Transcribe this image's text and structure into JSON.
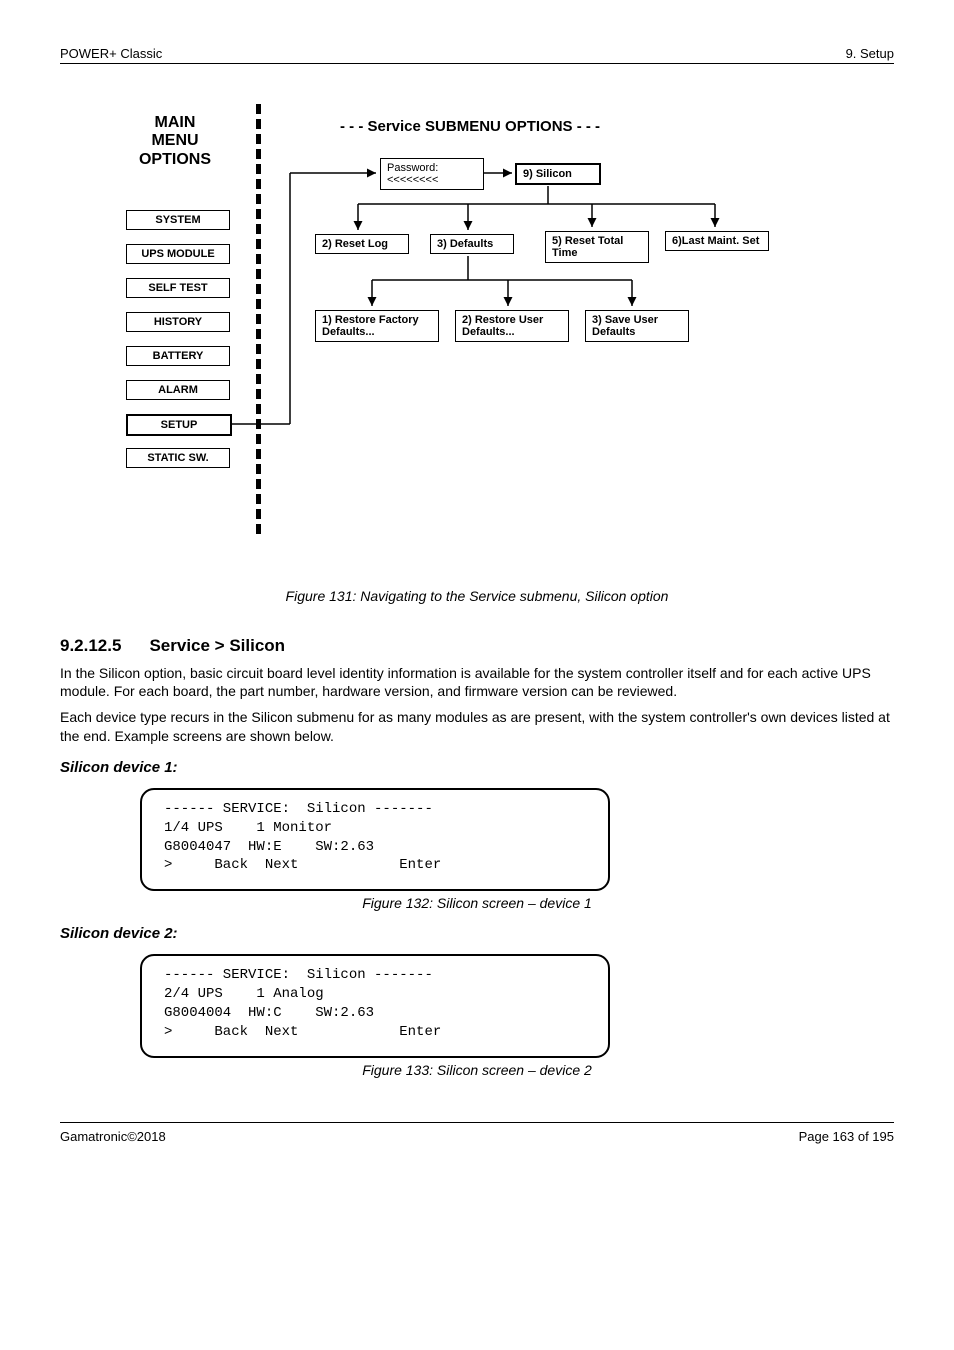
{
  "header": {
    "left": "POWER+ Classic",
    "right": "9. Setup"
  },
  "diagram": {
    "main_menu_title": "MAIN\nMENU\nOPTIONS",
    "main_items": [
      "SYSTEM",
      "UPS MODULE",
      "SELF TEST",
      "HISTORY",
      "BATTERY",
      "ALARM",
      "SETUP",
      "STATIC SW."
    ],
    "submenu_title": "- - -     Service SUBMENU OPTIONS     - - -",
    "password_box": "Password:\n<<<<<<<<",
    "silicon": "9) Silicon",
    "row2": [
      "2) Reset Log",
      "3) Defaults",
      "5) Reset Total Time",
      "6)Last Maint. Set"
    ],
    "row3": [
      "1) Restore Factory Defaults...",
      "2) Restore User Defaults...",
      "3) Save User Defaults"
    ]
  },
  "figure_caption": "Figure 131: Navigating to the Service submenu, Silicon option",
  "section": {
    "num": "9.2.12.5",
    "title": "Service > Silicon"
  },
  "body": {
    "p1": "In the Silicon option, basic circuit board level identity information is available for the system controller itself and for each active UPS module. For each board, the part number, hardware version, and firmware version can be reviewed.",
    "p2": "Each device type recurs in the Silicon submenu for as many modules as are present, with the system controller's own devices listed at the end. Example screens are shown below."
  },
  "device1": {
    "label": "Silicon device 1:",
    "lcd": {
      "l1": "------ SERVICE:  Silicon -------",
      "l2": "1/4 UPS    1 Monitor",
      "l3": "G8004047  HW:E    SW:2.63",
      "l4": ">     Back  Next            Enter"
    },
    "caption": "Figure 132: Silicon screen – device 1"
  },
  "device2": {
    "label": "Silicon device 2:",
    "lcd": {
      "l1": "------ SERVICE:  Silicon -------",
      "l2": "2/4 UPS    1 Analog",
      "l3": "G8004004  HW:C    SW:2.63",
      "l4": ">     Back  Next            Enter"
    },
    "caption": "Figure 133: Silicon screen – device 2"
  },
  "footer": {
    "left": "Gamatronic©2018",
    "right": "Page 163 of 195"
  }
}
